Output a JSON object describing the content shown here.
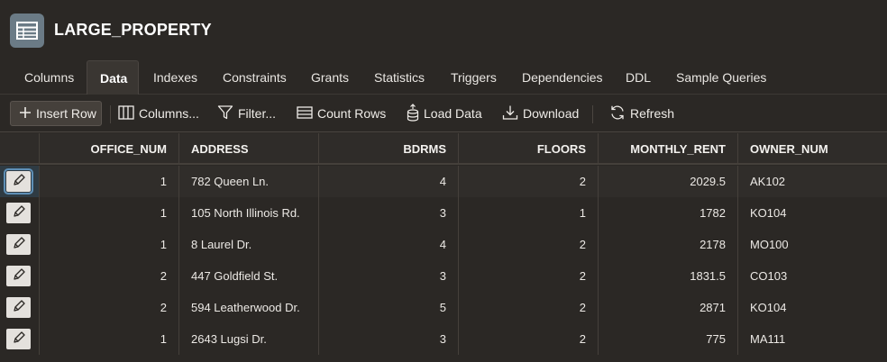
{
  "header": {
    "title": "LARGE_PROPERTY",
    "icon": "table-icon"
  },
  "tabs": [
    {
      "label": "Columns",
      "active": false
    },
    {
      "label": "Data",
      "active": true
    },
    {
      "label": "Indexes",
      "active": false
    },
    {
      "label": "Constraints",
      "active": false
    },
    {
      "label": "Grants",
      "active": false
    },
    {
      "label": "Statistics",
      "active": false
    },
    {
      "label": "Triggers",
      "active": false
    },
    {
      "label": "Dependencies",
      "active": false
    },
    {
      "label": "DDL",
      "active": false
    },
    {
      "label": "Sample Queries",
      "active": false
    }
  ],
  "toolbar": {
    "insert_row": "Insert Row",
    "columns": "Columns...",
    "filter": "Filter...",
    "count_rows": "Count Rows",
    "load_data": "Load Data",
    "download": "Download",
    "refresh": "Refresh"
  },
  "grid": {
    "columns": [
      "OFFICE_NUM",
      "ADDRESS",
      "BDRMS",
      "FLOORS",
      "MONTHLY_RENT",
      "OWNER_NUM"
    ],
    "rows": [
      [
        "1",
        "782 Queen Ln.",
        "4",
        "2",
        "2029.5",
        "AK102"
      ],
      [
        "1",
        "105 North Illinois Rd.",
        "3",
        "1",
        "1782",
        "KO104"
      ],
      [
        "1",
        "8 Laurel Dr.",
        "4",
        "2",
        "2178",
        "MO100"
      ],
      [
        "2",
        "447 Goldfield St.",
        "3",
        "2",
        "1831.5",
        "CO103"
      ],
      [
        "2",
        "594 Leatherwood Dr.",
        "5",
        "2",
        "2871",
        "KO104"
      ],
      [
        "1",
        "2643 Lugsi Dr.",
        "3",
        "2",
        "775",
        "MA111"
      ]
    ]
  },
  "colors": {
    "background": "#2b2825",
    "header_icon_bg": "#6b7b86",
    "active_tab": "#3a3632",
    "edit_button": "#e4e1dd"
  }
}
